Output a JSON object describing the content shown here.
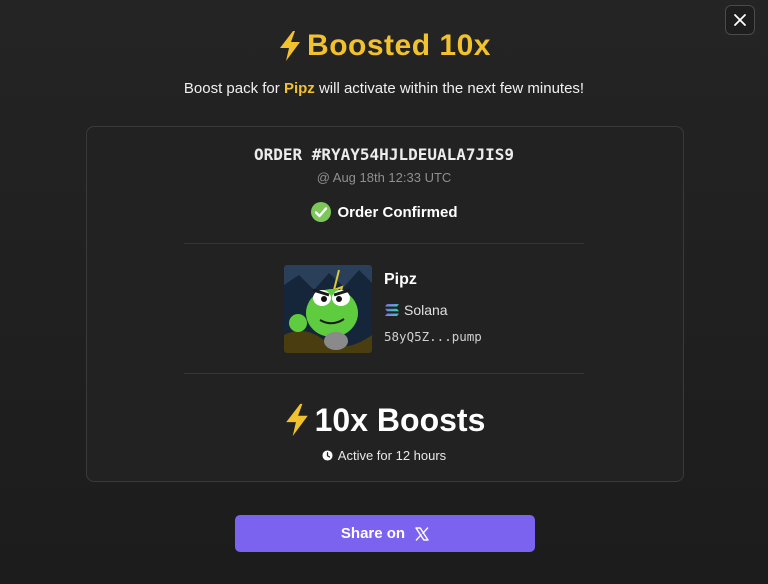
{
  "header": {
    "title": "Boosted 10x",
    "subtitle_prefix": "Boost pack for",
    "subtitle_token": "Pipz",
    "subtitle_suffix": "will activate within the next few minutes!"
  },
  "order": {
    "id": "ORDER #RYAY54HJLDEUALA7JIS9",
    "time": "@ Aug 18th 12:33 UTC",
    "status": "Order Confirmed"
  },
  "token": {
    "name": "Pipz",
    "chain": "Solana",
    "address": "58yQ5Z...pump"
  },
  "boost": {
    "label": "10x Boosts",
    "duration": "Active for 12 hours"
  },
  "share": {
    "label": "Share on"
  },
  "colors": {
    "accent": "#f2c12e",
    "button": "#7b63f0",
    "success": "#7cc65a"
  },
  "icons": [
    "close-icon",
    "lightning-icon",
    "check-circle-icon",
    "solana-icon",
    "clock-icon",
    "x-logo-icon"
  ]
}
